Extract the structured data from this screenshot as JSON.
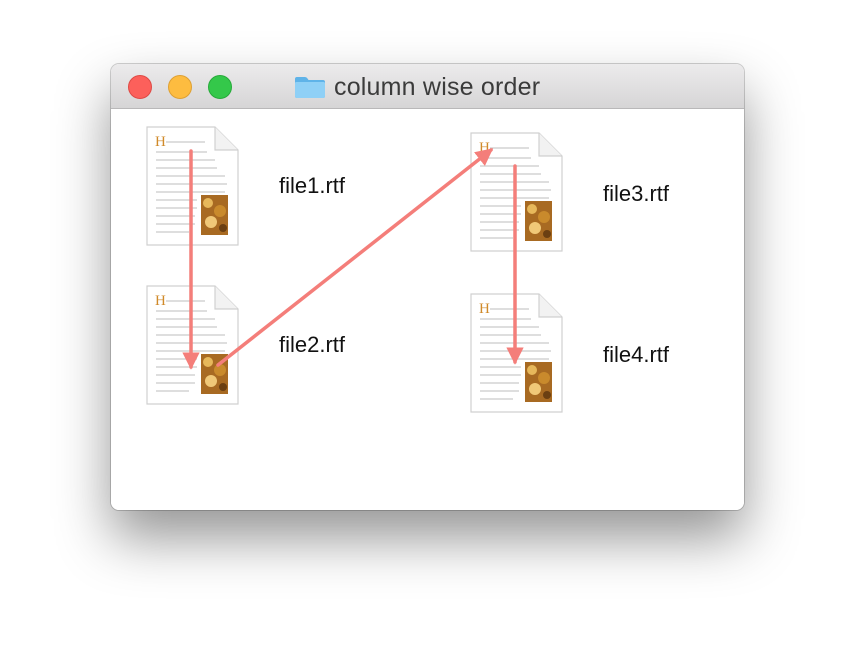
{
  "window": {
    "title": "column wise order",
    "title_icon": "folder-icon",
    "buttons": {
      "close": "close-button",
      "minimize": "minimize-button",
      "zoom": "zoom-button"
    }
  },
  "files": [
    {
      "name": "file1.rtf",
      "icon": "rtf-document-icon"
    },
    {
      "name": "file2.rtf",
      "icon": "rtf-document-icon"
    },
    {
      "name": "file3.rtf",
      "icon": "rtf-document-icon"
    },
    {
      "name": "file4.rtf",
      "icon": "rtf-document-icon"
    }
  ],
  "annotation": {
    "arrow_color": "#f47e7a"
  },
  "colors": {
    "close": "#fc605b",
    "minimize": "#fdbc40",
    "zoom": "#34c84a",
    "folder": "#73c0f0"
  }
}
